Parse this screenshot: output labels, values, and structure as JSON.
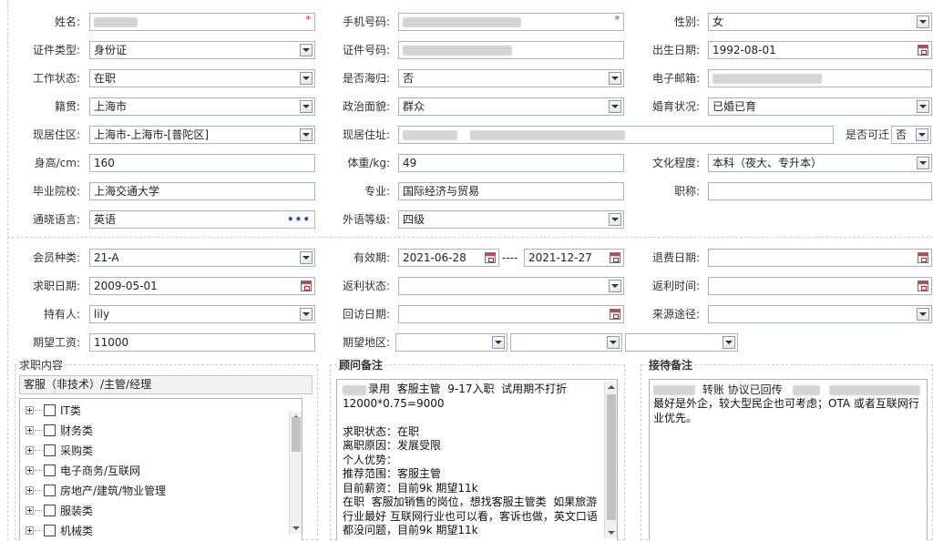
{
  "form": {
    "name_label": "姓名:",
    "phone_label": "手机号码:",
    "gender_label": "性别:",
    "gender_value": "女",
    "idtype_label": "证件类型:",
    "idtype_value": "身份证",
    "idno_label": "证件号码:",
    "birth_label": "出生日期:",
    "birth_value": "1992-08-01",
    "work_label": "工作状态:",
    "work_value": "在职",
    "overseas_label": "是否海归:",
    "overseas_value": "否",
    "email_label": "电子邮箱:",
    "native_label": "籍贯:",
    "native_value": "上海市",
    "political_label": "政治面貌:",
    "political_value": "群众",
    "marital_label": "婚育状况:",
    "marital_value": "已婚已育",
    "area_label": "现居住区:",
    "area_value": "上海市-上海市-[普陀区]",
    "addr_label": "现居住址:",
    "relocate_label": "是否可迁",
    "relocate_value": "否",
    "height_label": "身高/cm:",
    "height_value": "160",
    "weight_label": "体重/kg:",
    "weight_value": "49",
    "edu_label": "文化程度:",
    "edu_value": "本科（夜大、专升本）",
    "school_label": "毕业院校:",
    "school_value": "上海交通大学",
    "major_label": "专业:",
    "major_value": "国际经济与贸易",
    "title_label": "职称:",
    "lang_label": "通晓语言:",
    "lang_value": "英语",
    "lang_level_label": "外语等级:",
    "lang_level_value": "四级"
  },
  "member": {
    "type_label": "会员种类:",
    "type_value": "21-A",
    "valid_label": "有效期:",
    "valid_from": "2021-06-28",
    "valid_sep": "----",
    "valid_to": "2021-12-27",
    "refund_label": "退费日期:",
    "job_date_label": "求职日期:",
    "job_date_value": "2009-05-01",
    "rebate_status_label": "返利状态:",
    "rebate_time_label": "返利时间:",
    "holder_label": "持有人:",
    "holder_value": "lily",
    "visit_label": "回访日期:",
    "source_label": "来源途径:",
    "salary_label": "期望工资:",
    "salary_value": "11000",
    "region_label": "期望地区:"
  },
  "job_content": {
    "legend": "求职内容",
    "selected": "客服（非技术）/主管/经理",
    "tree": [
      "IT类",
      "财务类",
      "采购类",
      "电子商务/互联网",
      "房地产/建筑/物业管理",
      "服装类",
      "机械类"
    ]
  },
  "consultant_note": {
    "legend": "顾问备注",
    "text": "录用  客服主管  9-17入职  试用期不打折\n12000*0.75=9000\n\n求职状态：在职\n离职原因：发展受限\n个人优势：\n推荐范围：客服主管\n目前薪资：目前9k 期望11k\n在职  客服加销售的岗位，想找客服主管类  如果旅游行业最好 互联网行业也可以看，客诉也做，英文口语都没问题，目前9k 期望11k"
  },
  "reception_note": {
    "legend": "接待备注",
    "line1": "转账 协议已回传",
    "text": "最好是外企，较大型民企也可考虑；OTA 或者互联网行业优先。"
  }
}
